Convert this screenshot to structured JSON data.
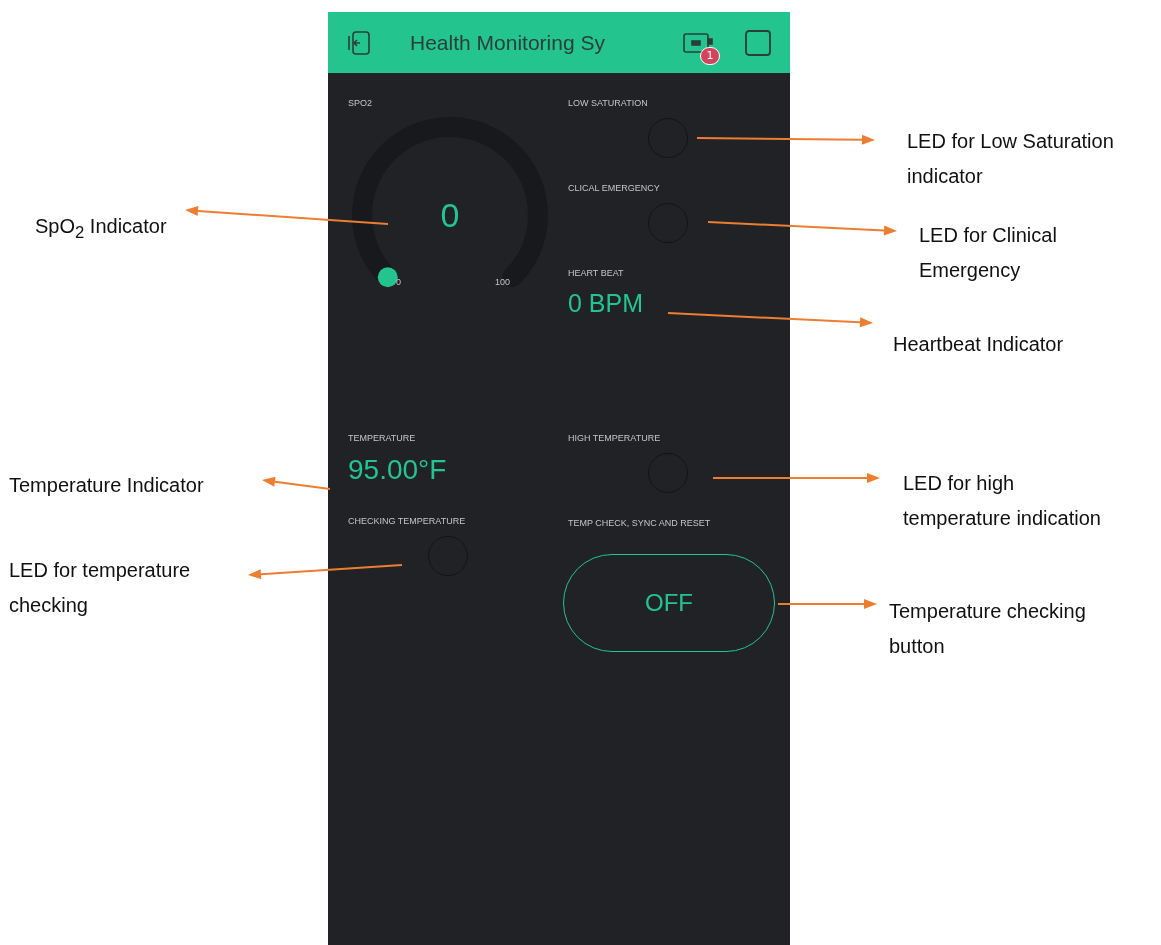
{
  "header": {
    "title": "Health Monitoring Sy",
    "badge": "1"
  },
  "left_widgets": [
    {
      "kind": "gauge",
      "label": "SPO2",
      "value": "0",
      "min": "0",
      "max": "100"
    },
    {
      "kind": "value",
      "label": "TEMPERATURE",
      "value": "95.00°F"
    },
    {
      "kind": "led",
      "label": "CHECKING TEMPERATURE",
      "on": false
    }
  ],
  "right_widgets": [
    {
      "kind": "led",
      "label": "LOW SATURATION",
      "on": false
    },
    {
      "kind": "led",
      "label": "CLICAL EMERGENCY",
      "on": false
    },
    {
      "kind": "value",
      "label": "HEART BEAT",
      "value": "0 BPM"
    },
    {
      "kind": "led",
      "label": "HIGH TEMPERATURE",
      "on": false
    },
    {
      "kind": "button",
      "label": "TEMP CHECK, SYNC AND RESET",
      "value": "OFF",
      "on": false
    }
  ],
  "annotations": [
    {
      "text": "SpO$_{2}$ Indicator"
    },
    {
      "text": "Temperature Indicator"
    },
    {
      "text": "LED for temperature\nchecking"
    },
    {
      "text": "LED for Low Saturation\nindicator"
    },
    {
      "text": "LED for Clinical\nEmergency"
    },
    {
      "text": "Heartbeat Indicator"
    },
    {
      "text": "LED for high\ntemperature indication"
    },
    {
      "text": "Temperature checking\nbutton"
    }
  ]
}
